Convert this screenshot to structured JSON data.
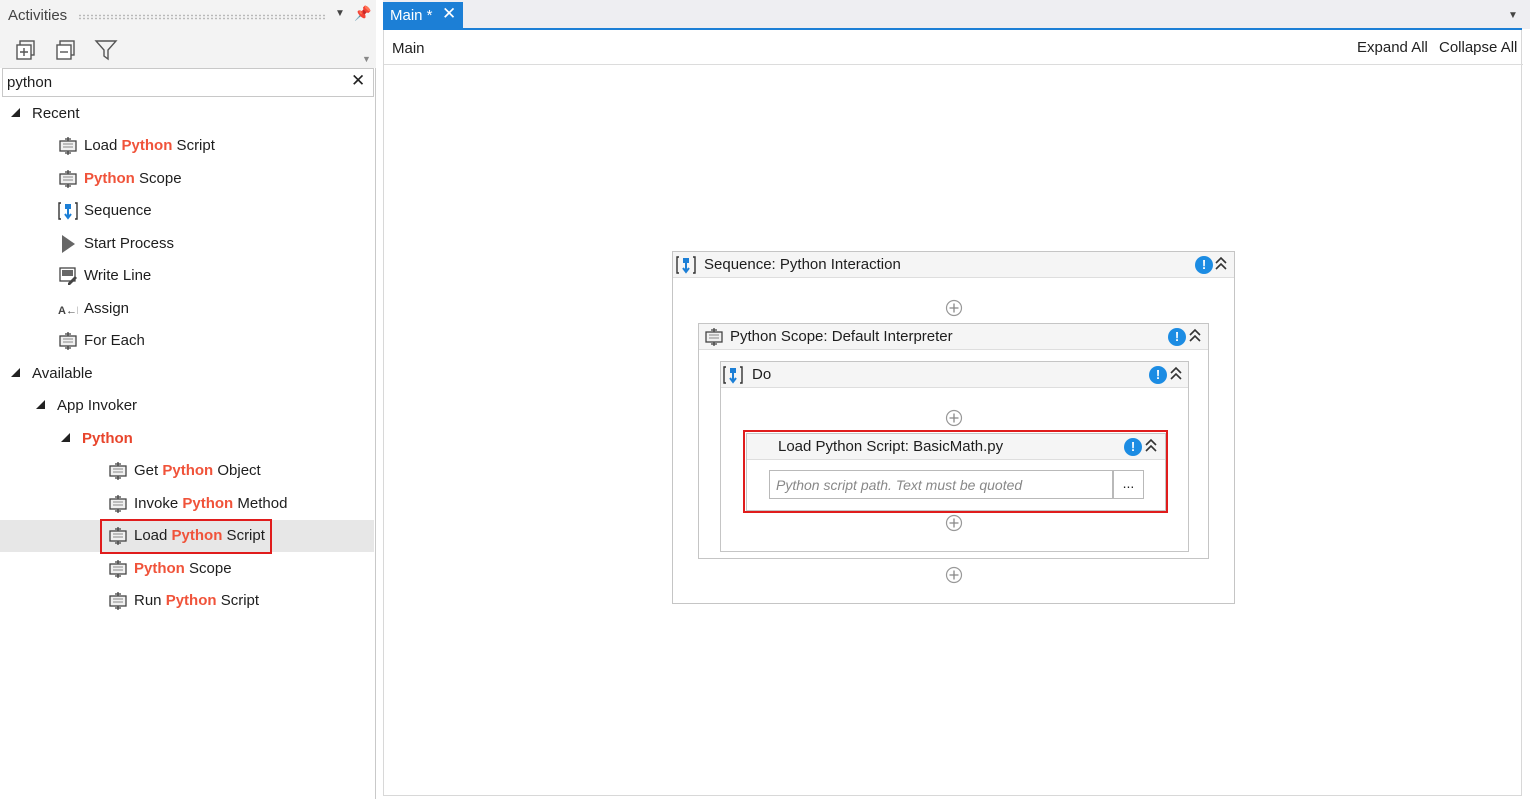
{
  "activities_panel": {
    "title": "Activities",
    "toolbar": {
      "expand_icon": "expand-all-icon",
      "collapse_icon": "collapse-all-icon",
      "filter_icon": "filter-icon"
    },
    "search": {
      "value": "python",
      "placeholder": ""
    },
    "tree": {
      "recent_label": "Recent",
      "recent_items": [
        {
          "pre": "Load ",
          "hi": "Python",
          "post": " Script",
          "icon": "activity-icon"
        },
        {
          "pre": "",
          "hi": "Python",
          "post": " Scope",
          "icon": "activity-icon"
        },
        {
          "pre": "Sequence",
          "hi": "",
          "post": "",
          "icon": "sequence-icon"
        },
        {
          "pre": "Start Process",
          "hi": "",
          "post": "",
          "icon": "play-icon"
        },
        {
          "pre": "Write Line",
          "hi": "",
          "post": "",
          "icon": "write-line-icon"
        },
        {
          "pre": "Assign",
          "hi": "",
          "post": "",
          "icon": "assign-icon"
        },
        {
          "pre": "For Each",
          "hi": "",
          "post": "",
          "icon": "activity-icon"
        }
      ],
      "available_label": "Available",
      "app_invoker_label": "App Invoker",
      "python_label": "Python",
      "python_items": [
        {
          "pre": "Get ",
          "hi": "Python",
          "post": " Object"
        },
        {
          "pre": "Invoke ",
          "hi": "Python",
          "post": " Method"
        },
        {
          "pre": "Load ",
          "hi": "Python",
          "post": " Script"
        },
        {
          "pre": "",
          "hi": "Python",
          "post": " Scope"
        },
        {
          "pre": "Run ",
          "hi": "Python",
          "post": " Script"
        }
      ]
    }
  },
  "document": {
    "tab_label": "Main *",
    "breadcrumb": "Main",
    "expand_all": "Expand All",
    "collapse_all": "Collapse All",
    "sequence_title": "Sequence: Python Interaction",
    "scope_title": "Python Scope: Default Interpreter",
    "do_title": "Do",
    "load_title": "Load Python Script: BasicMath.py",
    "path_placeholder": "Python script path. Text must be quoted",
    "browse_label": "...",
    "warning_glyph": "!"
  },
  "colors": {
    "accent": "#1c7fd6",
    "highlight": "#f0533a",
    "warning": "#1c8ce3",
    "annotation": "#e01c1c"
  }
}
